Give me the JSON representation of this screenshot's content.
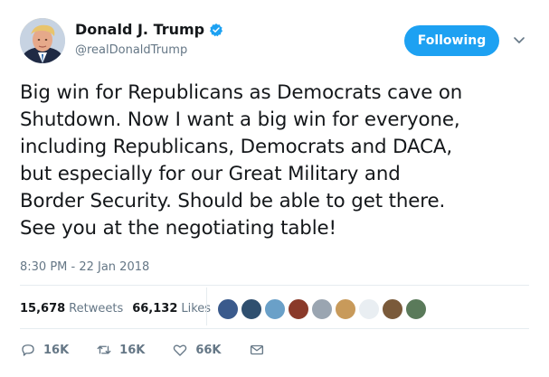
{
  "author": {
    "display_name": "Donald J. Trump",
    "handle": "@realDonaldTrump",
    "verified": true
  },
  "follow_button": {
    "label": "Following",
    "color": "#1da1f2"
  },
  "tweet": {
    "lines": [
      "Big win for Republicans as Democrats cave on",
      "Shutdown. Now I want a big win for everyone,",
      "including Republicans, Democrats and DACA,",
      "but especially for our Great Military and",
      "Border Security. Should be able to get there.",
      "See you at the negotiating table!"
    ],
    "timestamp": "8:30 PM - 22 Jan 2018"
  },
  "stats": {
    "retweets_count": "15,678",
    "retweets_label": "Retweets",
    "likes_count": "66,132",
    "likes_label": "Likes"
  },
  "liker_avatars": [
    {
      "name": "liker-1",
      "color": "#3a5a8c"
    },
    {
      "name": "liker-2",
      "color": "#2f4f6f"
    },
    {
      "name": "liker-3",
      "color": "#6aa0c8"
    },
    {
      "name": "liker-4",
      "color": "#8a3a2a"
    },
    {
      "name": "liker-5",
      "color": "#9aa5b1"
    },
    {
      "name": "liker-6",
      "color": "#c89a5a"
    },
    {
      "name": "liker-7",
      "color": "#e9eef2"
    },
    {
      "name": "liker-8",
      "color": "#7a5a3a"
    },
    {
      "name": "liker-9",
      "color": "#5a7a5a"
    }
  ],
  "actions": {
    "reply_count": "16K",
    "retweet_count": "16K",
    "like_count": "66K"
  },
  "colors": {
    "text": "#14171a",
    "muted": "#657786",
    "accent": "#1da1f2",
    "border": "#e6ecf0"
  },
  "icons": [
    "verified-badge-icon",
    "chevron-down-icon",
    "reply-icon",
    "retweet-icon",
    "like-icon",
    "direct-message-icon"
  ]
}
